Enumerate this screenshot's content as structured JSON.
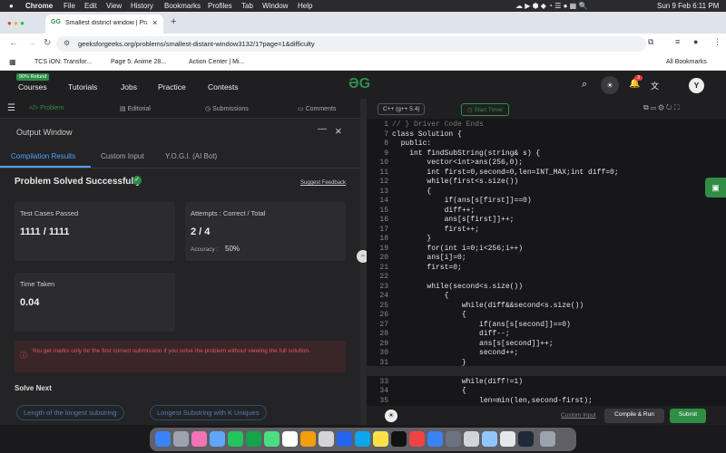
{
  "menubar": {
    "app": "Chrome",
    "items": [
      "File",
      "Edit",
      "View",
      "History",
      "Bookmarks",
      "Profiles",
      "Tab",
      "Window",
      "Help"
    ],
    "clock": "Sun 9 Feb  6:11 PM"
  },
  "tab": {
    "title": "Smallest distinct window | Pra"
  },
  "url": "geeksforgeeks.org/problems/smallest-distant-window3132/1?page=1&difficulty",
  "bookmarks": [
    "TCS iON: Transfor...",
    "Page 5: Anime 28...",
    "Action Center | Mi..."
  ],
  "all_bookmarks": "All Bookmarks",
  "gfg": {
    "badge": "90% Refund",
    "nav": [
      "Courses",
      "Tutorials",
      "Jobs",
      "Practice",
      "Contests"
    ],
    "notif": "3",
    "avatar": "Y"
  },
  "ptabs": [
    "Problem",
    "Editorial",
    "Submissions",
    "Comments"
  ],
  "output": {
    "title": "Output Window",
    "tabs": [
      "Compilation Results",
      "Custom Input",
      "Y.O.G.I. (AI Bot)"
    ],
    "status": "Problem Solved Successfully",
    "feedback": "Suggest Feedback",
    "tc_label": "Test Cases Passed",
    "tc_value": "1111 / 1111",
    "att_label": "Attempts : Correct / Total",
    "att_value": "2 / 4",
    "acc_label": "Accuracy :",
    "acc_value": "50%",
    "time_label": "Time Taken",
    "time_value": "0.04",
    "note": "You get marks only for the first correct submission if you solve the problem without viewing the full solution.",
    "solve_next": "Solve Next",
    "next": [
      "Length of the longest substring",
      "Longest Substring with K Uniques"
    ]
  },
  "editor": {
    "lang": "C++ (g++ 5.4)",
    "timer": "Start Timer",
    "custom_input": "Custom Input",
    "compile": "Compile & Run",
    "submit": "Submit",
    "lines": [
      {
        "n": "1",
        "t": "// } Driver Code Ends"
      },
      {
        "n": "7",
        "t": "class Solution {"
      },
      {
        "n": "8",
        "t": "  public:"
      },
      {
        "n": "9",
        "t": "    int findSubString(string& s) {"
      },
      {
        "n": "10",
        "t": "        vector<int>ans(256,0);"
      },
      {
        "n": "11",
        "t": "        int first=0,second=0,len=INT_MAX;int diff=0;"
      },
      {
        "n": "12",
        "t": "        while(first<s.size())"
      },
      {
        "n": "13",
        "t": "        {"
      },
      {
        "n": "14",
        "t": "            if(ans[s[first]]==0)"
      },
      {
        "n": "15",
        "t": "            diff++;"
      },
      {
        "n": "16",
        "t": "            ans[s[first]]++;"
      },
      {
        "n": "17",
        "t": "            first++;"
      },
      {
        "n": "18",
        "t": "        }"
      },
      {
        "n": "19",
        "t": "        for(int i=0;i<256;i++)"
      },
      {
        "n": "20",
        "t": "        ans[i]=0;"
      },
      {
        "n": "21",
        "t": "        first=0;"
      },
      {
        "n": "22",
        "t": ""
      },
      {
        "n": "23",
        "t": "        while(second<s.size())"
      },
      {
        "n": "24",
        "t": "            {"
      },
      {
        "n": "25",
        "t": "                while(diff&&second<s.size())"
      },
      {
        "n": "26",
        "t": "                {"
      },
      {
        "n": "27",
        "t": "                    if(ans[s[second]]==0)"
      },
      {
        "n": "28",
        "t": "                    diff--;"
      },
      {
        "n": "29",
        "t": "                    ans[s[second]]++;"
      },
      {
        "n": "30",
        "t": "                    second++;"
      },
      {
        "n": "31",
        "t": "                }"
      },
      {
        "n": "32",
        "t": "                len=min(len,second-first);"
      },
      {
        "n": "33",
        "t": "                while(diff!=1)"
      },
      {
        "n": "34",
        "t": "                {"
      },
      {
        "n": "35",
        "t": "                    len=min(len,second-first);"
      }
    ]
  }
}
